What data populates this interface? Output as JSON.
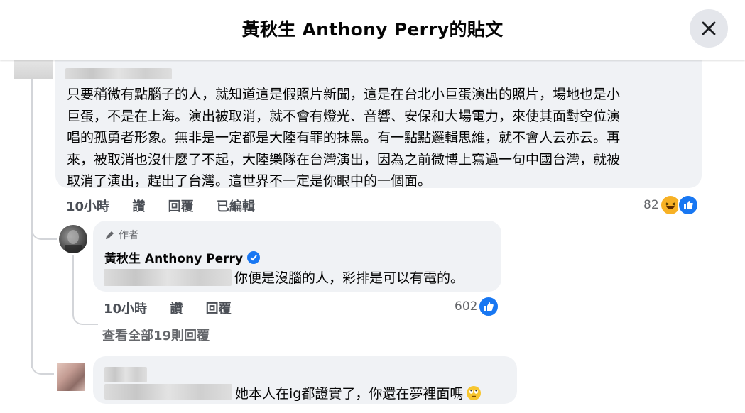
{
  "header": {
    "title": "黃秋生 Anthony Perry的貼文"
  },
  "comment1": {
    "lines": [
      "只要稍微有點腦子的人，就知道這是假照片新聞，這是在台北小巨蛋演出的照片，場地也是小",
      "巨蛋，不是在上海。演出被取消，就不會有燈光、音響、安保和大場電力，來使其面對空位演",
      "唱的孤勇者形象。無非是一定都是大陸有罪的抹黑。有一點點邏輯思維，就不會人云亦云。再",
      "來，被取消也沒什麼了不起，大陸樂隊在台灣演出，因為之前微博上寫過一句中國台灣，就被",
      "取消了演出，趕出了台灣。這世界不一定是你眼中的一個面。"
    ],
    "time": "10小時",
    "like_label": "讚",
    "reply_label": "回覆",
    "edited_label": "已編輯",
    "reaction_count": "82",
    "reactions": [
      "haha-icon",
      "like-icon"
    ]
  },
  "reply1": {
    "author_tag": "作者",
    "author_name": "黃秋生 Anthony Perry",
    "text": "你便是沒腦的人，彩排是可以有電的。",
    "time": "10小時",
    "like_label": "讚",
    "reply_label": "回覆",
    "reaction_count": "602",
    "reactions": [
      "like-icon"
    ]
  },
  "view_all_replies": "查看全部19則回覆",
  "comment2": {
    "text": "她本人在ig都證實了，你還在夢裡面嗎",
    "emoji": "face-with-rolling-eyes"
  },
  "colors": {
    "accent": "#1877f2",
    "bubble": "#f0f2f5",
    "secondary_text": "#65676b"
  }
}
